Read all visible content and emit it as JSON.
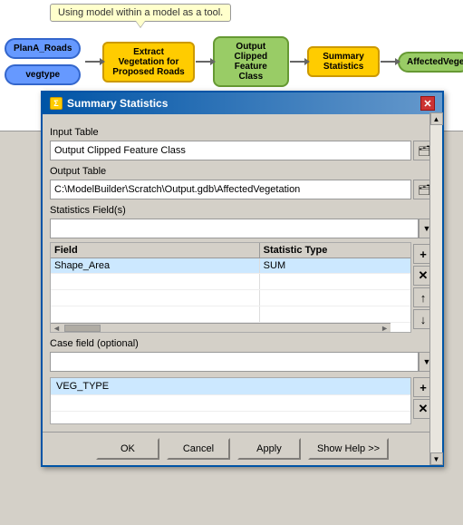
{
  "diagram": {
    "callout_text": "Using model within a model as a tool.",
    "nodes": {
      "planA_roads": "PlanA_Roads",
      "vegtype": "vegtype",
      "extract": "Extract Vegetation for Proposed Roads",
      "output_clipped": "Output Clipped Feature Class",
      "summary_stats": "Summary Statistics",
      "affected_veg": "AffectedVegetation"
    }
  },
  "dialog": {
    "title": "Summary Statistics",
    "input_table_label": "Input Table",
    "input_table_value": "Output Clipped Feature Class",
    "output_table_label": "Output Table",
    "output_table_value": "C:\\ModelBuilder\\Scratch\\Output.gdb\\AffectedVegetation",
    "statistics_fields_label": "Statistics Field(s)",
    "table_headers": {
      "field": "Field",
      "statistic_type": "Statistic Type"
    },
    "table_rows": [
      {
        "field": "Shape_Area",
        "statistic_type": "SUM"
      }
    ],
    "case_field_label": "Case field (optional)",
    "case_field_value": "VEG_TYPE",
    "buttons": {
      "ok": "OK",
      "cancel": "Cancel",
      "apply": "Apply",
      "show_help": "Show Help >>"
    },
    "add_icon": "+",
    "remove_icon": "✕",
    "up_icon": "↑",
    "down_icon": "↓",
    "close_icon": "✕",
    "folder_icon": "📁",
    "dropdown_icon": "▼"
  }
}
